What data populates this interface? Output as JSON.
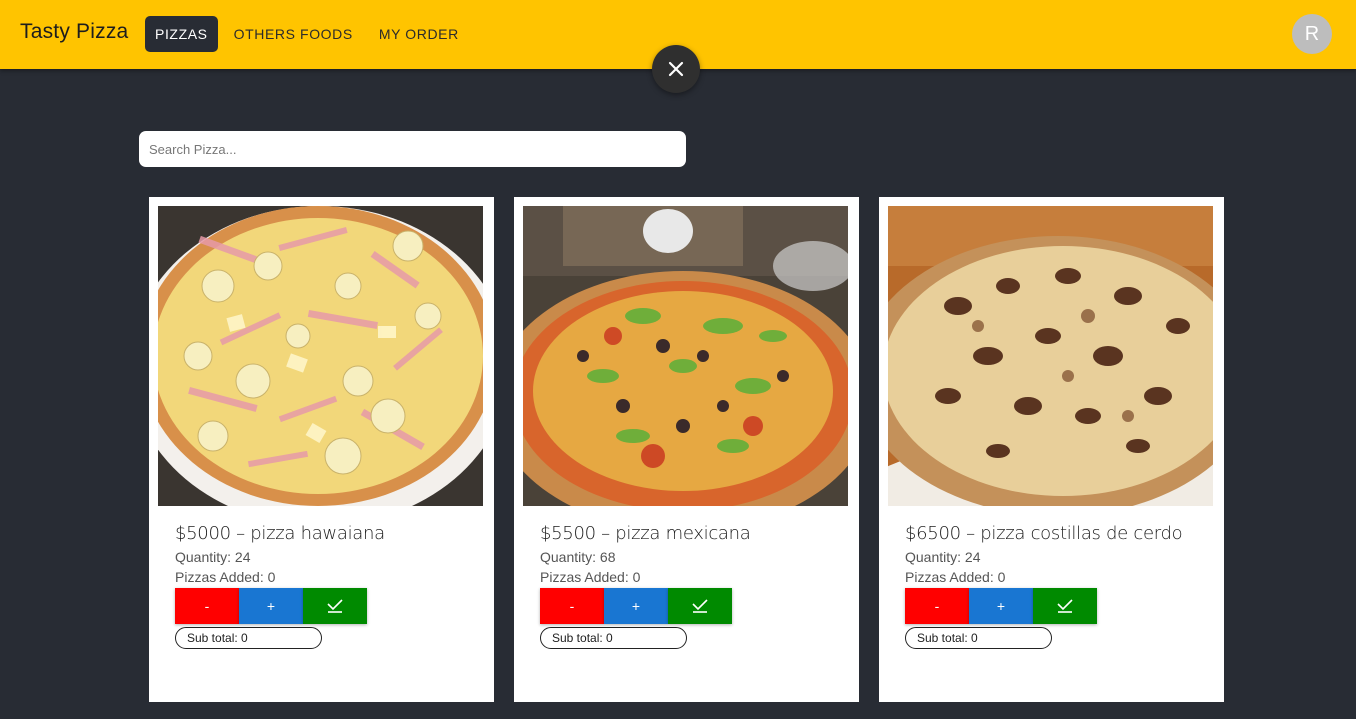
{
  "header": {
    "brand": "Tasty Pizza",
    "nav": [
      {
        "label": "PIZZAS",
        "active": true
      },
      {
        "label": "OTHERS FOODS",
        "active": false
      },
      {
        "label": "MY ORDER",
        "active": false
      }
    ],
    "avatar_letter": "R",
    "brand_color": "#ffc400"
  },
  "search": {
    "placeholder": "Search Pizza..."
  },
  "products": [
    {
      "title": "$5000 – pizza hawaiana",
      "quantity": "Quantity: 24",
      "added": "Pizzas Added: 0",
      "minus_label": "-",
      "plus_label": "+",
      "subtotal": "Sub total: 0"
    },
    {
      "title": "$5500 – pizza mexicana",
      "quantity": "Quantity: 68",
      "added": "Pizzas Added: 0",
      "minus_label": "-",
      "plus_label": "+",
      "subtotal": "Sub total: 0"
    },
    {
      "title": "$6500 – pizza costillas de cerdo",
      "quantity": "Quantity: 24",
      "added": "Pizzas Added: 0",
      "minus_label": "-",
      "plus_label": "+",
      "subtotal": "Sub total: 0"
    }
  ],
  "colors": {
    "background": "#282c34",
    "minus": "#ff0000",
    "plus": "#1976d2",
    "confirm": "#008a00"
  }
}
